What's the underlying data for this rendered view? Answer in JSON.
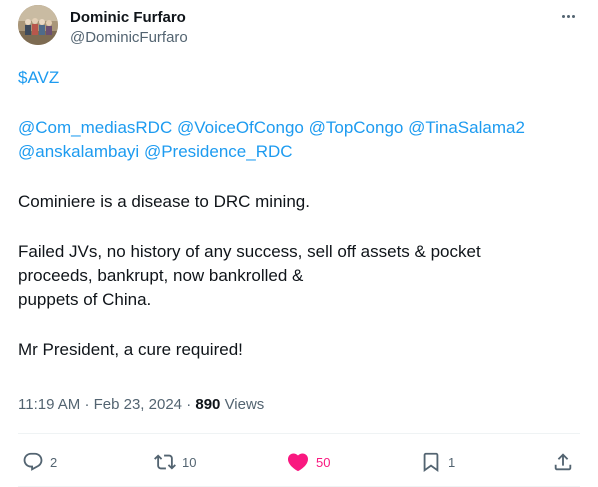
{
  "author": {
    "name": "Dominic Furfaro",
    "handle": "@DominicFurfaro"
  },
  "tweet": {
    "cashtag": "$AVZ",
    "mentions": [
      "@Com_mediasRDC",
      "@VoiceOfCongo",
      "@TopCongo",
      "@TinaSalama2",
      "@anskalambayi",
      "@Presidence_RDC"
    ],
    "line1": "Cominiere is a disease to DRC mining.",
    "para2_line1": "Failed JVs, no history of any success, sell off assets & pocket",
    "para2_line2": "proceeds, bankrupt, now bankrolled &",
    "para2_line3": "puppets of China.",
    "line3": "Mr President, a cure required!"
  },
  "meta": {
    "time": "11:19 AM",
    "separator": "·",
    "date": "Feb 23, 2024",
    "views_count": "890",
    "views_label": "Views"
  },
  "actions": {
    "replies": "2",
    "retweets": "10",
    "likes": "50",
    "bookmarks": "1"
  },
  "colors": {
    "link": "#1d9bf0",
    "like": "#f91880",
    "secondary": "#536471"
  },
  "icons": {
    "reply": "reply-icon",
    "retweet": "retweet-icon",
    "like": "heart-filled-icon",
    "bookmark": "bookmark-icon",
    "share": "share-icon",
    "more": "more-horizontal-icon"
  }
}
